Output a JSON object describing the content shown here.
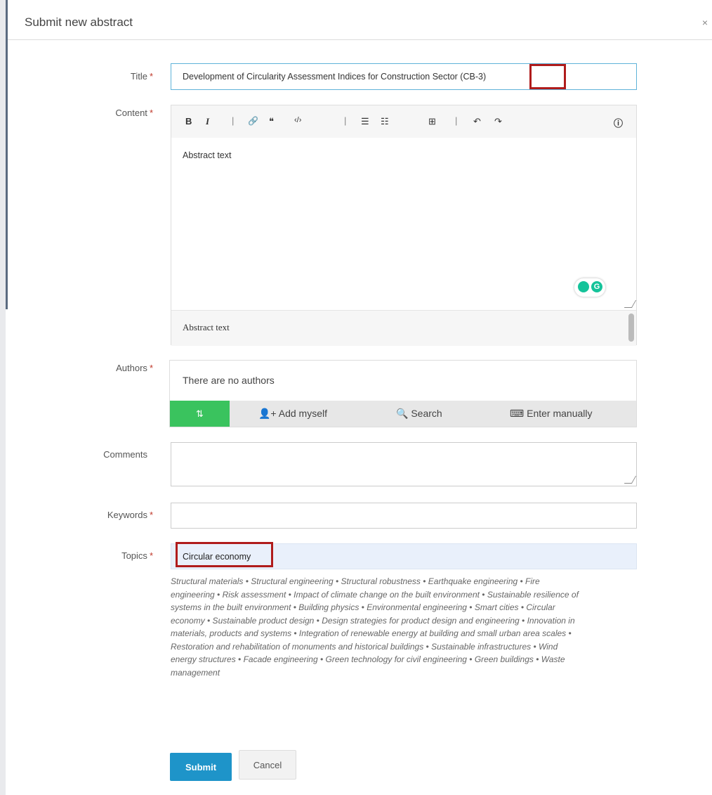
{
  "modal": {
    "title": "Submit new abstract",
    "close_label": "×"
  },
  "labels": {
    "title": "Title",
    "content": "Content",
    "authors": "Authors",
    "comments": "Comments",
    "keywords": "Keywords",
    "topics": "Topics",
    "required_marker": "*"
  },
  "title_field": {
    "value": "Development of Circularity Assessment Indices for Construction Sector (CB-3)"
  },
  "editor": {
    "toolbar": {
      "bold": "B",
      "italic": "I",
      "sep": "|",
      "link_icon": "🔗",
      "quote_icon": "❝",
      "code_icon": "‹/›",
      "ol_icon": "☰",
      "ul_icon": "☷",
      "insert_icon": "⊞",
      "undo_icon": "↶",
      "redo_icon": "↷",
      "info_icon": "ⓘ"
    },
    "content": "Abstract text",
    "preview": "Abstract text"
  },
  "authors": {
    "empty": "There are no authors",
    "sort_icon": "⇅",
    "add_myself": "Add myself",
    "search": "Search",
    "enter_manually": "Enter manually"
  },
  "comments": {
    "value": ""
  },
  "keywords": {
    "value": ""
  },
  "topics": {
    "selected": "Circular economy",
    "options_text": "Structural materials • Structural engineering • Structural robustness • Earthquake engineering • Fire engineering • Risk assessment • Impact of climate change on the built environment • Sustainable resilience of systems in the built environment • Building physics • Environmental engineering • Smart cities • Circular economy • Sustainable product design • Design strategies for product design and engineering • Innovation in materials, products and systems • Integration of renewable energy at building and small urban area scales • Restoration and rehabilitation of monuments and historical buildings • Sustainable infrastructures • Wind energy structures • Facade engineering • Green technology for civil engineering • Green buildings • Waste management"
  },
  "buttons": {
    "submit": "Submit",
    "cancel": "Cancel"
  },
  "colors": {
    "accent": "#1e94c9",
    "green": "#3ac35e",
    "highlight": "#b01c1c",
    "required": "#c0392b"
  }
}
